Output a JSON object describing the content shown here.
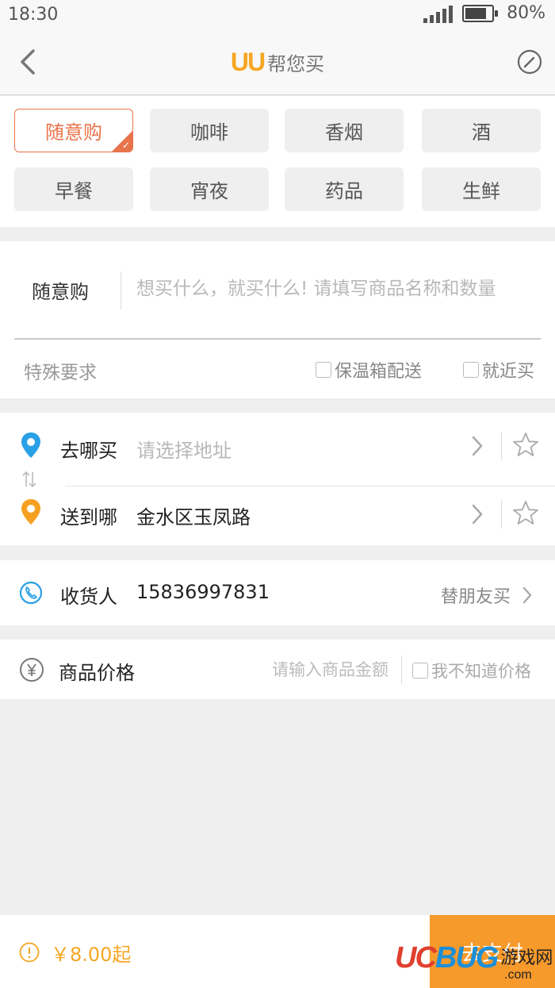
{
  "status_bar": {
    "time": "18:30",
    "battery": "80%"
  },
  "header": {
    "logo_mark": "UU",
    "title": "帮您买"
  },
  "categories": [
    {
      "label": "随意购",
      "selected": true
    },
    {
      "label": "咖啡",
      "selected": false
    },
    {
      "label": "香烟",
      "selected": false
    },
    {
      "label": "酒",
      "selected": false
    },
    {
      "label": "早餐",
      "selected": false
    },
    {
      "label": "宵夜",
      "selected": false
    },
    {
      "label": "药品",
      "selected": false
    },
    {
      "label": "生鲜",
      "selected": false
    }
  ],
  "item": {
    "label": "随意购",
    "placeholder": "想买什么，就买什么! 请填写商品名称和数量",
    "special_label": "特殊要求",
    "options": [
      "保温箱配送",
      "就近买"
    ]
  },
  "address": {
    "from": {
      "label": "去哪买",
      "value": "请选择地址"
    },
    "to": {
      "label": "送到哪",
      "value": "金水区玉凤路"
    }
  },
  "receiver": {
    "label": "收货人",
    "phone": "15836997831",
    "friend_label": "替朋友买"
  },
  "price": {
    "label": "商品价格",
    "placeholder": "请输入商品金额",
    "unknown_label": "我不知道价格"
  },
  "bottom": {
    "total": "￥8.00起",
    "pay_label": "去支付"
  },
  "watermark": {
    "uc": "UC",
    "bug": "BUG",
    "cn": "游戏网",
    "com": ".com"
  },
  "colors": {
    "accent": "#f79a2c",
    "selected": "#e8734a",
    "from_pin": "#2aa0e6",
    "to_pin": "#f5a021",
    "phone_icon": "#2aa0e6"
  },
  "icons": [
    "back-arrow-icon",
    "edit-icon",
    "check-icon",
    "location-pin-icon",
    "swap-icon",
    "chevron-right-icon",
    "star-icon",
    "phone-icon",
    "yen-icon",
    "info-icon"
  ]
}
